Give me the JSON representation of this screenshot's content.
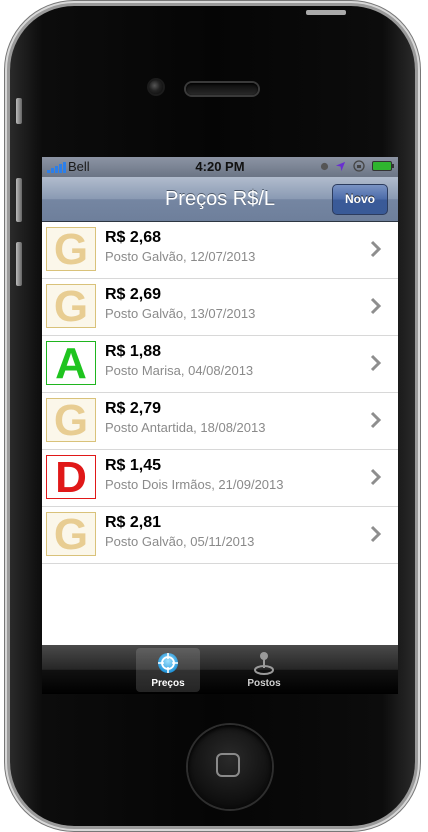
{
  "status_bar": {
    "carrier": "Bell",
    "time": "4:20 PM"
  },
  "nav": {
    "title": "Preços R$/L",
    "new_button": "Novo"
  },
  "prices": [
    {
      "grade": "G",
      "price": "R$ 2,68",
      "detail": "Posto Galvão, 12/07/2013"
    },
    {
      "grade": "G",
      "price": "R$ 2,69",
      "detail": "Posto Galvão, 13/07/2013"
    },
    {
      "grade": "A",
      "price": "R$ 1,88",
      "detail": "Posto Marisa, 04/08/2013"
    },
    {
      "grade": "G",
      "price": "R$ 2,79",
      "detail": "Posto Antartida, 18/08/2013"
    },
    {
      "grade": "D",
      "price": "R$ 1,45",
      "detail": "Posto Dois Irmãos, 21/09/2013"
    },
    {
      "grade": "G",
      "price": "R$ 2,81",
      "detail": "Posto Galvão, 05/11/2013"
    }
  ],
  "tabs": [
    {
      "label": "Preços",
      "icon": "target-icon",
      "active": true
    },
    {
      "label": "Postos",
      "icon": "joystick-pin-icon",
      "active": false
    }
  ],
  "colors": {
    "grade_G": "#e8cd92",
    "grade_A": "#1fc41f",
    "grade_D": "#e01818",
    "nav_button": "#4a6aa8"
  }
}
